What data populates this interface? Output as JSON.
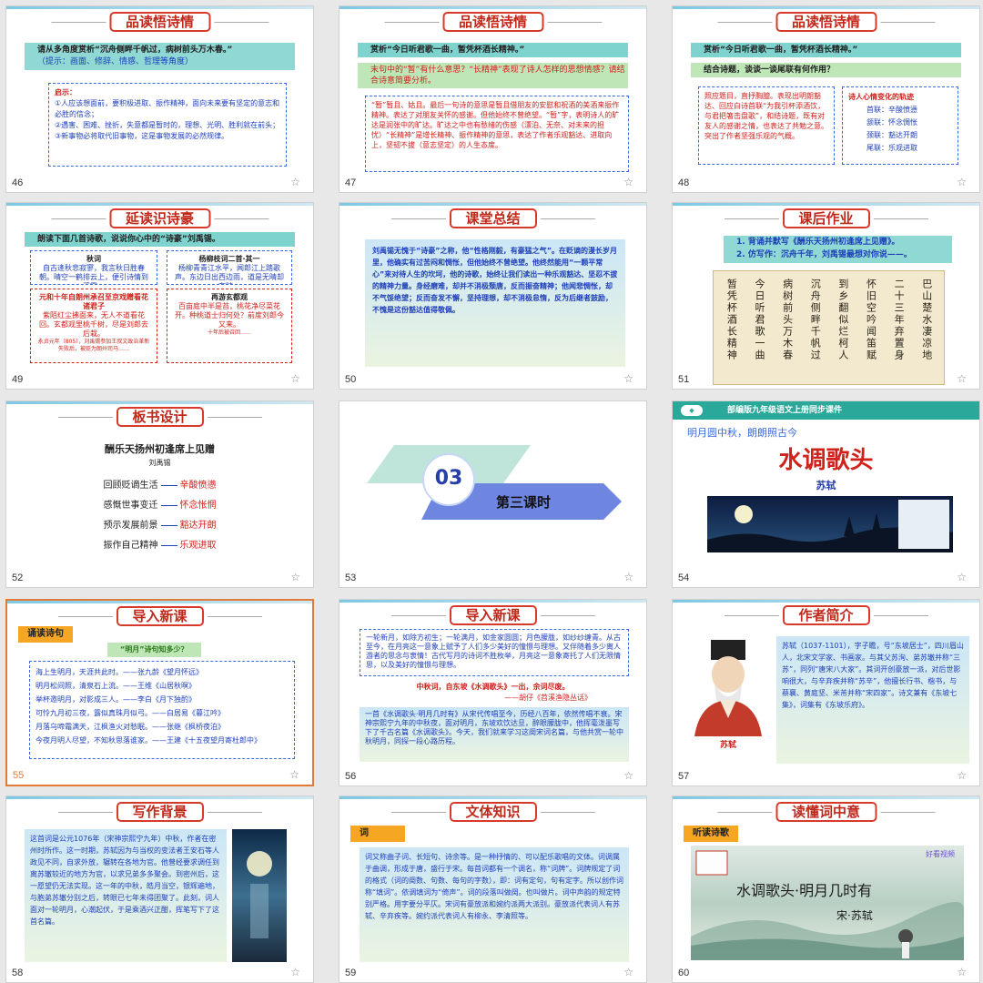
{
  "slides": [
    {
      "num": "46",
      "title": "品读悟诗情",
      "band": "请从多角度赏析“沉舟侧畔千帆过，病树前头万木春。”",
      "hint": "（提示：画面、修辞、情感、哲理等角度）",
      "box_title": "启示：",
      "lines": [
        "①人应该想面前，要积极进取、振作精神，面向未来要有坚定的意志和必胜的信念；",
        "②遇害、困难、挫折，失意都是暂时的，理想、光明、胜利就在前头；",
        "③新事物必将取代旧事物，这是事物发展的必然规律。"
      ]
    },
    {
      "num": "47",
      "title": "品读悟诗情",
      "band": "赏析“今日听君歌一曲，暂凭杯酒长精神。”",
      "question": "末句中的“暂”有什么意思？“长精神”表现了诗人怎样的思想情感？请结合诗意简要分析。",
      "answer": "“暂”暂且、姑且。最后一句诗的意思是暂且借朋友的安慰和祝酒的美酒来振作精神。表达了对朋友关怀的感谢。但他始终不曾绝望。“暂”字，表明诗人的旷达是润张中的旷达。旷达之中也有愁绪的伤感（漂泊、无奈、对未来的担忧）“长精神”是增长精神、振作精神的意思，表达了作者乐观豁达、进取向上，坚韧不拔（意志坚定）的人生态度。"
    },
    {
      "num": "48",
      "title": "品读悟诗情",
      "band": "赏析“今日听君歌一曲，暂凭杯酒长精神。”",
      "band2": "结合诗题，谈谈一谈尾联有何作用？",
      "answer": "照应题目，直抒胸臆。表现出明朗豁达、回应白诗首联“为我引杯添酒饮，与君把箸击盘歌”，和结诗题，既有对友人的感谢之情，也表达了共勉之意。突出了作者坚强乐观的气概。",
      "trace_title": "诗人心情变化的轨迹",
      "trace": [
        "首联：辛酸愤懑",
        "颔联：怀念惆怅",
        "颈联：豁达开朗",
        "尾联：乐观进取"
      ]
    },
    {
      "num": "49",
      "title": "延读识诗豪",
      "band": "朗读下面几首诗歌，说说你心中的“诗豪”刘禹锡。",
      "poems": [
        {
          "title": "秋词",
          "text": "自古逢秋悲寂寥，我言秋日胜春朝。晴空一鹤排云上，便引诗情到碧霄。"
        },
        {
          "title": "杨柳枝词二首·其一",
          "text": "杨柳青青江水平，闻郎江上踏歌声。东边日出西边雨，道是无晴却有晴。"
        },
        {
          "title": "元和十年自朗州承召至京戏赠看花诸君子",
          "text": "紫陌红尘拂面来，无人不道看花回。玄都观里桃千树，尽是刘郎去后栽。"
        },
        {
          "title": "再游玄都观",
          "text": "百亩庭中半是苔，桃花净尽菜花开。种桃道士归何处？前度刘郎今又来。"
        }
      ],
      "notes": [
        "永贞元年（805），刘禹锡参加王叔文政治革新失败后，被贬为朗州司马……",
        "十年后被召回……"
      ]
    },
    {
      "num": "50",
      "title": "课堂总结",
      "text": "刘禹锡无愧于“诗豪”之称，他“性格刚毅，有豪猛之气”。在贬谪的漫长岁月里，他确实有过苦闷和惆怅，但他始终不曾绝望。他终然能用“一颗平常心”来对待人生的坎坷，他的诗歌，始终让我们读出一种乐观豁达、坚忍不拔的精神力量。身经磨难，却并不消极颓唐，反而振奋精神；他闻悲惆怅，却不气馁绝望；反而奋发不懈，坚持理想，却不消极怠惰，反为后继者鼓励，不愧是这份豁达值得敬佩。"
    },
    {
      "num": "51",
      "title": "课后作业",
      "tasks": [
        "1. 背诵并默写《酬乐天扬州初逢席上见赠》。",
        "2. 仿写作：沉舟千年，刘禹锡最想对你说——。"
      ],
      "calligraphy": [
        "巴山楚水凄凉地",
        "二十三年弃置身",
        "怀旧空吟闻笛赋",
        "到乡翻似烂柯人",
        "沉舟侧畔千帆过",
        "病树前头万木春",
        "今日听君歌一曲",
        "暂凭杯酒长精神"
      ]
    },
    {
      "num": "52",
      "title": "板书设计",
      "heading": "酬乐天扬州初逢席上见赠",
      "author": "刘禹锡",
      "rows": [
        {
          "k": "回顾贬谪生活",
          "v": "辛酸愤懑"
        },
        {
          "k": "感慨世事变迁",
          "v": "怀念怅惘"
        },
        {
          "k": "预示发展前景",
          "v": "豁达开朗"
        },
        {
          "k": "振作自己精神",
          "v": "乐观进取"
        }
      ]
    },
    {
      "num": "53",
      "label_num": "03",
      "label": "第三课时"
    },
    {
      "num": "54",
      "banner": "部编版九年级语文上册同步课件",
      "subtitle": "明月圆中秋，朗朗照古今",
      "title": "水调歌头",
      "author": "苏轼"
    },
    {
      "num": "55",
      "title": "导入新课",
      "tag": "诵读诗句",
      "prompt": "“明月”诗句知多少？",
      "poems": [
        "海上生明月，天涯共此时。——张九龄《望月怀远》",
        "明月松间照，清泉石上流。——王维《山居秋暝》",
        "举杯邀明月，对影成三人。——李白《月下独酌》",
        "可怜九月初三夜，露似真珠月似弓。——白居易《暮江吟》",
        "月落乌啼霜满天，江枫渔火对愁眠。——张继《枫桥夜泊》",
        "今夜月明人尽望，不知秋思落谁家。——王建《十五夜望月寄杜郎中》"
      ]
    },
    {
      "num": "56",
      "title": "导入新课",
      "intro": "一轮新月，如除方初生；一轮满月，如金家圆圆；月色朦胧，如纱纱缠青。从古至今，在月亮这一意象上赋予了人们多少美好的憧憬与理想。又伴随着多少离人游者的思念与衷情！古代写月的诗词不胜枚举，月亮这一意象寄托了人们无限情思，以及美好的憧憬与理想。",
      "quote": "中秋词，自东坡《水调歌头》一出，余词尽废。",
      "quote_src": "——胡仔《苕溪渔隐丛话》",
      "outro": "一首《水调歌头·明月几时有》从宋代传唱至今，历经八百年，依然传唱不衰。宋神宗熙宁九年的中秋夜，面对明月，东坡欢饮达旦，醉眼朦胧中，他挥毫泼墨写下了千古名篇《水调歌头》。今天，我们就来学习这阕宋词名篇，与他共赏一轮中秋明月，同探一段心路历程。"
    },
    {
      "num": "57",
      "title": "作者简介",
      "bio": "苏轼（1037-1101），字子瞻，号“东坡居士”，四川眉山人，北宋文学家、书画家。与其父苏洵、弟苏辙并称“三苏”，同列“唐宋八大家”。其词开创豪放一派，对后世影响很大，与辛弃疾并称“苏辛”，他擅长行书、楷书，与蔡襄、黄庭坚、米芾并称“宋四家”。诗文兼有《东坡七集》，词集有《东坡乐府》。",
      "caption": "苏轼"
    },
    {
      "num": "58",
      "title": "写作背景",
      "text": "这首词是公元1076年（宋神宗熙宁九年）中秋，作者在密州时所作。这一时期，苏轼因为与当权的变法者王安石等人政见不同，自求外放，辗转在各地为官。他曾经要求调任到离苏辙较近的地方为官，以求兄弟多多聚会。到密州后，这一愿望仍无法实现。这一年的中秋，皓月当空，银辉遍地，与胞弟苏辙分别之后，转眼已七年未得团聚了。此刻，词人面对一轮明月，心潮起伏，于是乘酒兴正酣，挥笔写下了这首名篇。"
    },
    {
      "num": "59",
      "title": "文体知识",
      "tag": "词",
      "text": "词又称曲子词、长短句、诗余等。是一种抒情的、可以配乐歌唱的文体。词调属于曲调，形成于唐，盛行于宋。每首词都有一个调名，称“词牌”。词牌规定了词的格式（词的阕数、句数、每句的字数），即：词有定句，句有定字。所以创作词称“填词”。依调填词为“倚声”。词的段落叫做阕。也叫做片。词中声韵的规定特别严格。用字要分平仄。宋词有豪放派和婉约派两大派别。豪放派代表词人有苏轼、辛弃疾等。婉约派代表词人有柳永、李清照等。"
    },
    {
      "num": "60",
      "title": "读懂词中意",
      "tag": "听读诗歌",
      "video_title": "水调歌头·明月几时有",
      "video_author": "宋·苏轼",
      "video_brand": "好看视频"
    }
  ],
  "icons": {
    "star": "star-icon"
  }
}
